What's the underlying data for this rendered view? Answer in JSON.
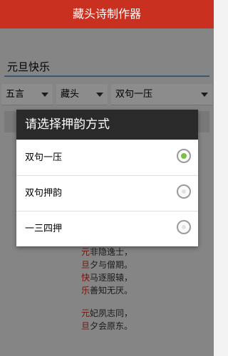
{
  "app": {
    "title": "藏头诗制作器"
  },
  "input": {
    "value": "元旦快乐"
  },
  "spinners": [
    {
      "label": "五言"
    },
    {
      "label": "藏头"
    },
    {
      "label": "双句一压"
    }
  ],
  "poem": {
    "stanzas": [
      [
        {
          "head": "元",
          "rest": "非隐逸士，"
        },
        {
          "head": "旦",
          "rest": "夕与僧期。"
        },
        {
          "head": "快",
          "rest": "马逐服辕，"
        },
        {
          "head": "乐",
          "rest": "善知无厌。"
        }
      ],
      [
        {
          "head": "元",
          "rest": "妃夙志同，"
        },
        {
          "head": "旦",
          "rest": "夕会原东。"
        }
      ]
    ]
  },
  "dialog": {
    "title": "请选择押韵方式",
    "options": [
      {
        "label": "双句一压",
        "selected": true
      },
      {
        "label": "双句押韵",
        "selected": false
      },
      {
        "label": "一三四押",
        "selected": false
      }
    ]
  },
  "colors": {
    "titlebar": "#c9301f",
    "accent": "#7bc043",
    "head_char": "#dd2211"
  }
}
